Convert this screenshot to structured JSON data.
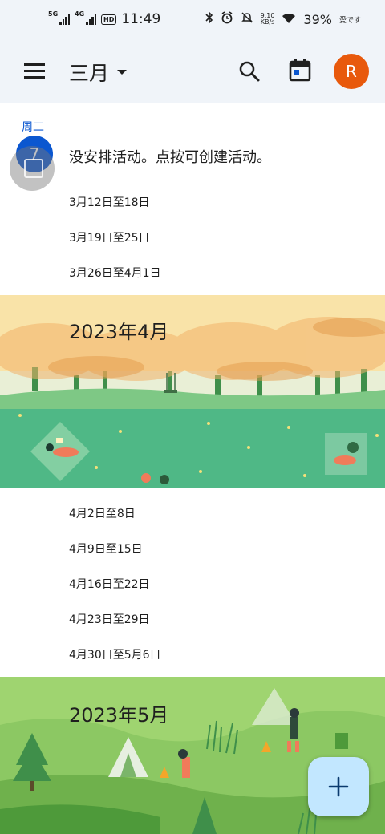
{
  "status_bar": {
    "sim1_label": "5G",
    "sim2_label": "4G",
    "hd_label": "HD",
    "time": "11:49",
    "net_speed": "9.10",
    "net_speed_unit": "KB/s",
    "battery": "39%",
    "carrier_text": "愛です"
  },
  "app_bar": {
    "month_title": "三月",
    "avatar_initial": "R"
  },
  "day": {
    "weekday": "周二",
    "date": "7",
    "empty_message": "没安排活动。点按可创建活动。"
  },
  "weeks_march": [
    "3月12日至18日",
    "3月19日至25日",
    "3月26日至4月1日"
  ],
  "april": {
    "title": "2023年4月",
    "weeks": [
      "4月2日至8日",
      "4月9日至15日",
      "4月16日至22日",
      "4月23日至29日",
      "4月30日至5月6日"
    ]
  },
  "may": {
    "title": "2023年5月"
  },
  "icons": {
    "menu": "menu-icon",
    "dropdown": "caret-down-icon",
    "search": "search-icon",
    "today": "calendar-today-icon",
    "add": "plus-icon"
  },
  "colors": {
    "accent": "#0b57d0",
    "app_bar_bg": "#f0f4f9",
    "avatar_bg": "#e8590c",
    "fab_bg": "#c2e7ff",
    "april_sky": "#f9e3a8",
    "april_grass": "#4fb886",
    "may_grass": "#9fd470"
  }
}
